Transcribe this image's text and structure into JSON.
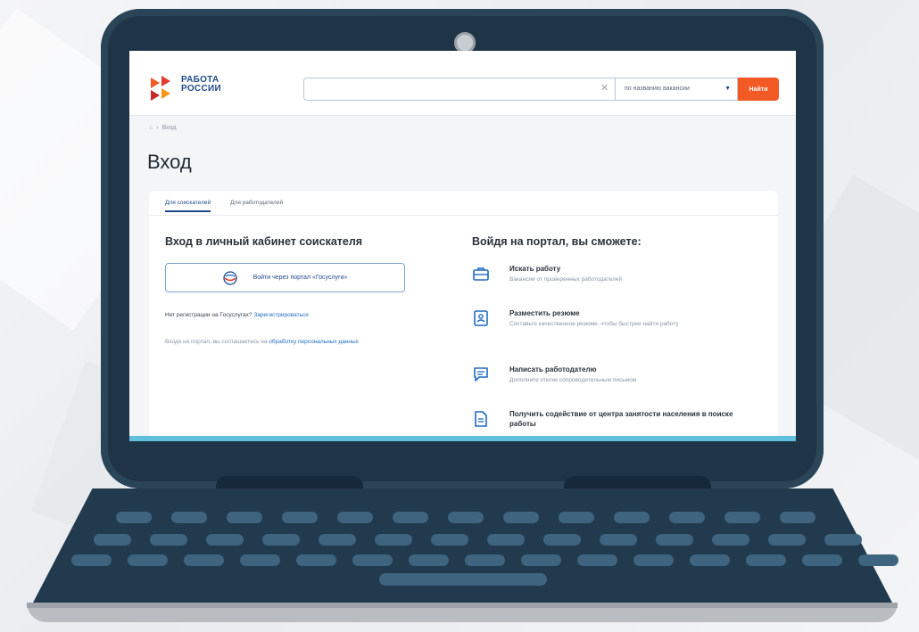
{
  "colors": {
    "brand_blue": "#1e4a8a",
    "accent_orange": "#f15a25",
    "link_blue": "#1e6bc2",
    "laptop_body": "#1f3547",
    "screen_bottom_bar": "#5fc1dd",
    "key_color": "#3e6480"
  },
  "header": {
    "logo_line1": "РАБОТА",
    "logo_line2": "РОССИИ",
    "search_value": "",
    "search_mode": "по названию вакансии",
    "search_button": "Найти",
    "logo_icon": "logo-arrows-icon",
    "clear_icon": "close-icon"
  },
  "breadcrumb": {
    "current": "Вход",
    "home_icon": "home-icon"
  },
  "page": {
    "title": "Вход"
  },
  "tabs": [
    {
      "label": "Для соискателей",
      "active": true
    },
    {
      "label": "Для работодателей",
      "active": false
    }
  ],
  "login": {
    "title": "Вход в личный кабинет соискателя",
    "gosuslugi_button": "Войти через портал «Госуслуги»",
    "no_registration": "Нет регистрации на Госуслугах?",
    "register_link": "Зарегистрироваться",
    "consent_text": "Входя на портал, вы соглашаетесь на",
    "consent_link": "обработку персональных данных"
  },
  "features": {
    "title": "Войдя на портал, вы сможете:",
    "items": [
      {
        "title": "Искать работу",
        "desc": "Вакансии от проверенных работодателей",
        "icon": "briefcase-icon"
      },
      {
        "title": "Разместить резюме",
        "desc": "Составьте качественное резюме, чтобы быстрее найти работу",
        "icon": "resume-icon"
      },
      {
        "title": "Написать работодателю",
        "desc": "Дополните отклик сопроводительным письмом",
        "icon": "chat-icon"
      },
      {
        "title": "Получить содействие от центра занятости населения в поиске работы",
        "desc": "",
        "icon": "document-icon"
      }
    ]
  }
}
